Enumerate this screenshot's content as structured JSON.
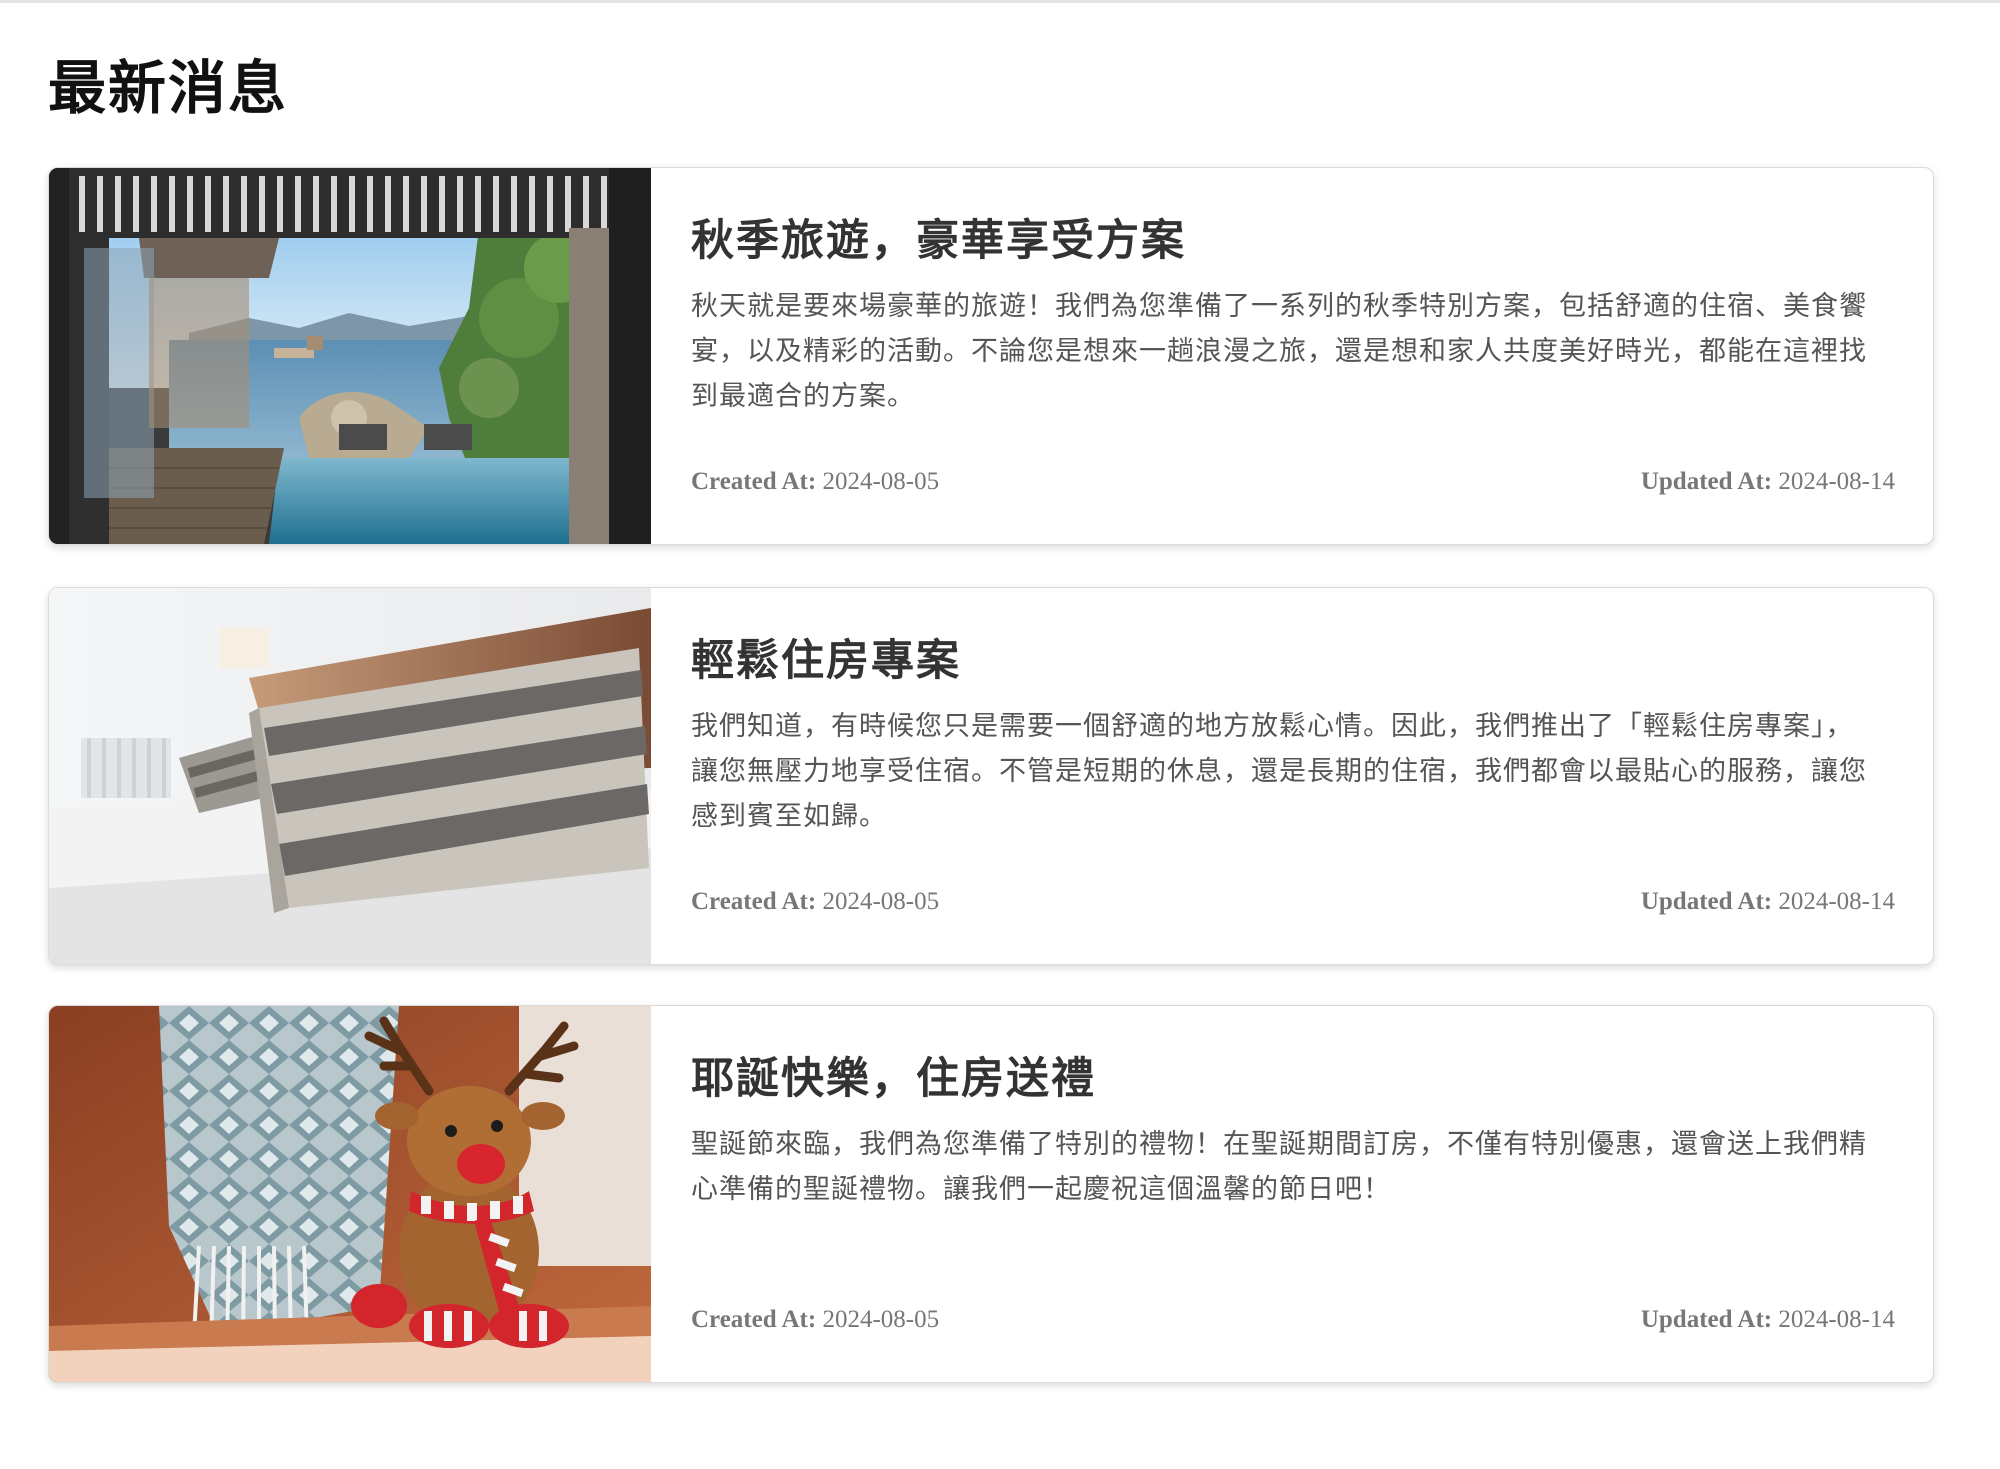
{
  "page": {
    "title": "最新消息"
  },
  "news": [
    {
      "title": "秋季旅遊，豪華享受方案",
      "description": "秋天就是要來場豪華的旅遊！我們為您準備了一系列的秋季特別方案，包括舒適的住宿、美食饗宴，以及精彩的活動。不論您是想來一趟浪漫之旅，還是想和家人共度美好時光，都能在這裡找到最適合的方案。",
      "created_label": "Created At:",
      "created": "2024-08-05",
      "updated_label": "Updated At:",
      "updated": "2024-08-14",
      "image": "villa-pool-sea-view-photo"
    },
    {
      "title": "輕鬆住房專案",
      "description": "我們知道，有時候您只是需要一個舒適的地方放鬆心情。因此，我們推出了「輕鬆住房專案」，讓您無壓力地享受住宿。不管是短期的休息，還是長期的住宿，我們都會以最貼心的服務，讓您感到賓至如歸。",
      "created_label": "Created At:",
      "created": "2024-08-05",
      "updated_label": "Updated At:",
      "updated": "2024-08-14",
      "image": "striped-pillows-bed-photo"
    },
    {
      "title": "耶誕快樂，住房送禮",
      "description": "聖誕節來臨，我們為您準備了特別的禮物！在聖誕期間訂房，不僅有特別優惠，還會送上我們精心準備的聖誕禮物。讓我們一起慶祝這個溫馨的節日吧！",
      "created_label": "Created At:",
      "created": "2024-08-05",
      "updated_label": "Updated At:",
      "updated": "2024-08-14",
      "image": "reindeer-plush-toy-photo"
    }
  ],
  "colors": {
    "card_border": "#dcdcdc",
    "title_text": "#333333",
    "body_text": "#555555",
    "meta_text": "#777777"
  }
}
